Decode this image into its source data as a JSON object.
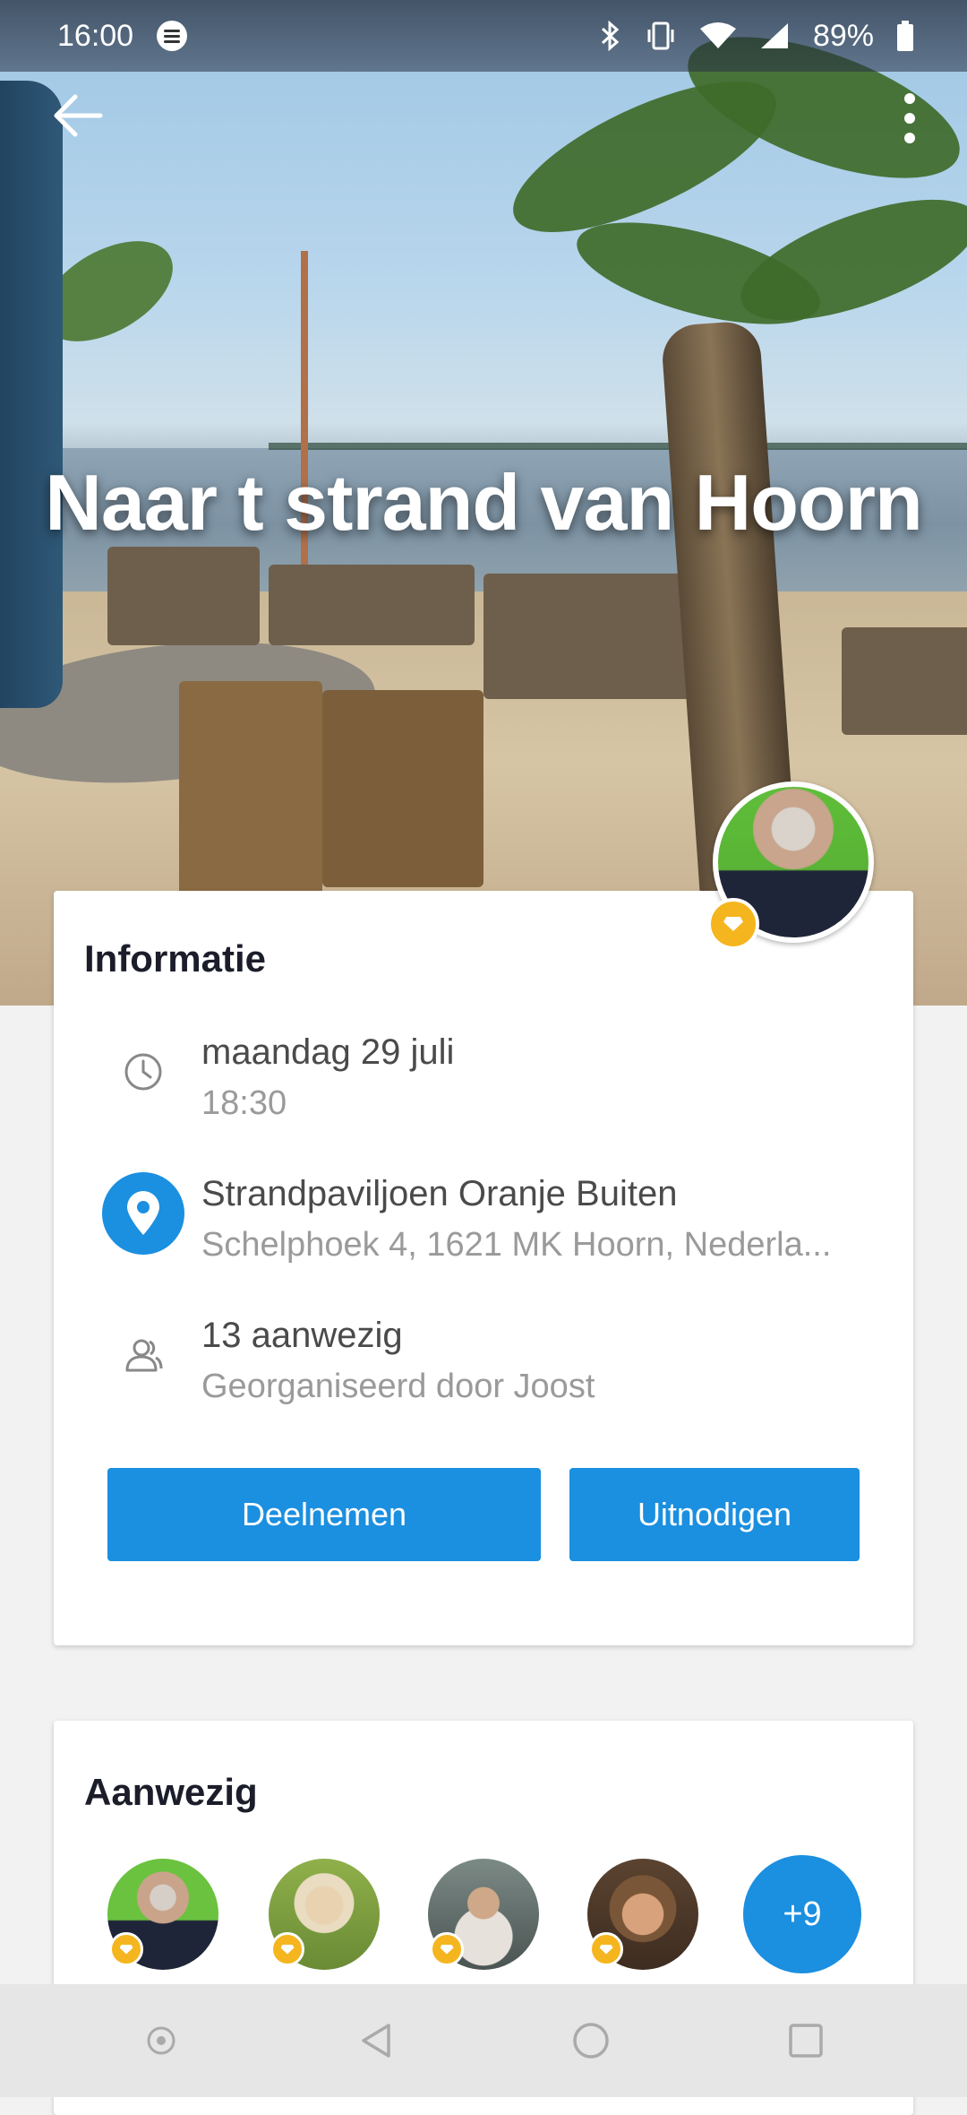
{
  "status_bar": {
    "time": "16:00",
    "battery": "89%",
    "icons": [
      "spotify-icon",
      "bluetooth-icon",
      "vibrate-icon",
      "wifi-icon",
      "signal-icon",
      "battery-icon"
    ]
  },
  "event": {
    "title": "Naar t strand van Hoorn"
  },
  "info": {
    "heading": "Informatie",
    "date": "maandag 29 juli",
    "time": "18:30",
    "venue": "Strandpaviljoen Oranje Buiten",
    "address": "Schelphoek 4, 1621 MK Hoorn, Nederla...",
    "attendees_count": "13 aanwezig",
    "organizer": "Georganiseerd door Joost",
    "join_label": "Deelnemen",
    "invite_label": "Uitnodigen"
  },
  "attendees": {
    "heading": "Aanwezig",
    "more_label": "+9"
  },
  "colors": {
    "accent": "#1b8fe0",
    "badge": "#f5b51e",
    "title_text": "#1b1d2a"
  }
}
